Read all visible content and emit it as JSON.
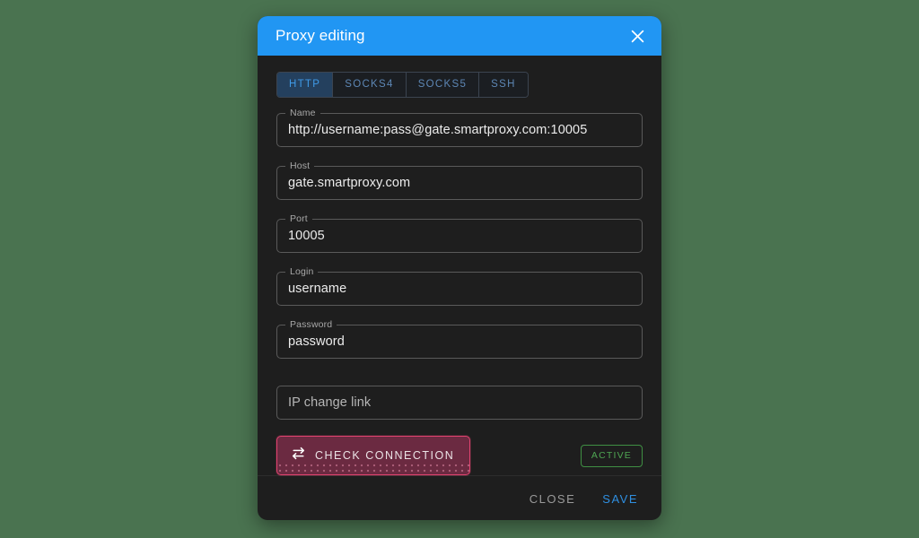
{
  "page": {
    "background_color": "#4a7350"
  },
  "dialog": {
    "title": "Proxy editing",
    "header_color": "#2196f3",
    "close_icon": "close-icon"
  },
  "tabs": {
    "selected": "HTTP",
    "items": [
      {
        "label": "HTTP",
        "selected": true
      },
      {
        "label": "SOCKS4",
        "selected": false
      },
      {
        "label": "SOCKS5",
        "selected": false
      },
      {
        "label": "SSH",
        "selected": false
      }
    ]
  },
  "form": {
    "fields": [
      {
        "label": "Name",
        "value": "http://username:pass@gate.smartproxy.com:10005",
        "placeholder": ""
      },
      {
        "label": "Host",
        "value": "gate.smartproxy.com",
        "placeholder": ""
      },
      {
        "label": "Port",
        "value": "10005",
        "placeholder": ""
      },
      {
        "label": "Login",
        "value": "username",
        "placeholder": ""
      },
      {
        "label": "Password",
        "value": "password",
        "placeholder": ""
      }
    ],
    "ip_change_link": {
      "label": "",
      "value": "",
      "placeholder": "IP change link"
    }
  },
  "actions": {
    "check_connection": {
      "label": "CHECK CONNECTION",
      "icon": "swap-horizontal-icon",
      "border_color": "#e0436f",
      "fill_color": "#6b2a41"
    },
    "status_badge": {
      "label": "ACTIVE",
      "color": "#4fa653"
    }
  },
  "footer": {
    "close_label": "CLOSE",
    "save_label": "SAVE",
    "save_color": "#2f8fe0"
  }
}
